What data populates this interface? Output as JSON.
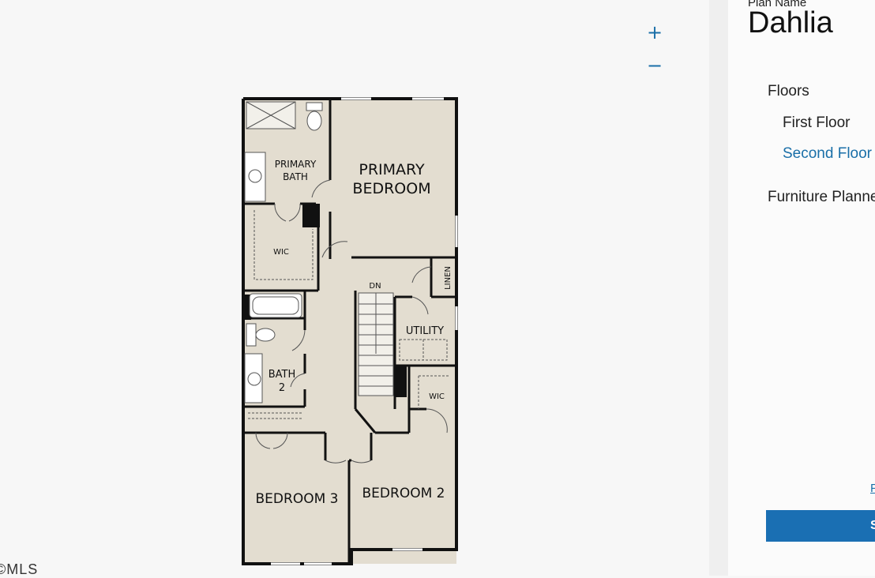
{
  "viewer": {
    "zoom_in_icon": "+",
    "zoom_out_icon": "−",
    "floorplan": {
      "rooms": {
        "primary_bedroom_1": "PRIMARY",
        "primary_bedroom_2": "BEDROOM",
        "primary_bath_1": "PRIMARY",
        "primary_bath_2": "BATH",
        "wic_primary": "WIC",
        "dn": "DN",
        "linen": "LINEN",
        "utility": "UTILITY",
        "wic_2": "WIC",
        "bath2_1": "BATH",
        "bath2_2": "2",
        "bedroom3": "BEDROOM 3",
        "bedroom2": "BEDROOM 2"
      }
    },
    "watermark": "©MLS"
  },
  "sidebar": {
    "plan_name_label": "Plan Name",
    "plan_name": "Dahlia",
    "nav": {
      "floors": "Floors",
      "first_floor": "First Floor",
      "second_floor": "Second Floor",
      "furniture_planner": "Furniture Planne"
    },
    "link_text": "F",
    "button_text": "S"
  },
  "colors": {
    "accent": "#1a6fa8",
    "button": "#1a6fb3",
    "room_fill": "#e3ddd0",
    "wall": "#111111"
  }
}
